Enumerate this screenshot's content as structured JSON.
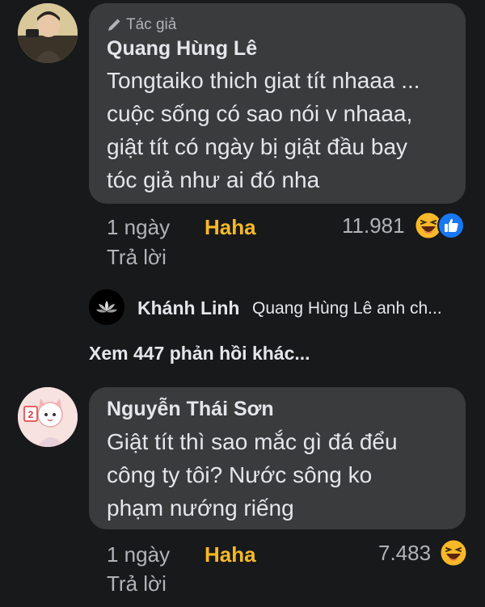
{
  "comments": [
    {
      "author_badge": "Tác giả",
      "author_badge_icon": "pencil-icon",
      "name": "Quang Hùng Lê",
      "lines": [
        "Tongtaiko thich giat tít nhaaa ...",
        "cuộc sống có sao nói v nhaaa,",
        "giật tít có ngày bị giật đầu bay",
        "tóc giả như ai đó nha"
      ],
      "time": "1 ngày",
      "reaction_label": "Haha",
      "reaction_count": "11.981",
      "reaction_icons": [
        "haha-emoji-icon",
        "like-icon"
      ],
      "reply_label": "Trả lời"
    },
    {
      "name": "Nguyễn Thái Sơn",
      "lines": [
        "Giật tít thì sao mắc gì đá đểu",
        "công ty tôi? Nước sông ko",
        "phạm nướng riếng"
      ],
      "time": "1 ngày",
      "reaction_label": "Haha",
      "reaction_count": "7.483",
      "reaction_icons": [
        "haha-emoji-icon"
      ],
      "reply_label": "Trả lời"
    }
  ],
  "reply_preview": {
    "name": "Khánh Linh",
    "text": "Quang Hùng Lê anh ch..."
  },
  "more_replies": "Xem 447 phản hồi khác...",
  "colors": {
    "background": "#18191a",
    "bubble": "#3a3b3c",
    "haha": "#f7b928",
    "like": "#1877f2"
  }
}
